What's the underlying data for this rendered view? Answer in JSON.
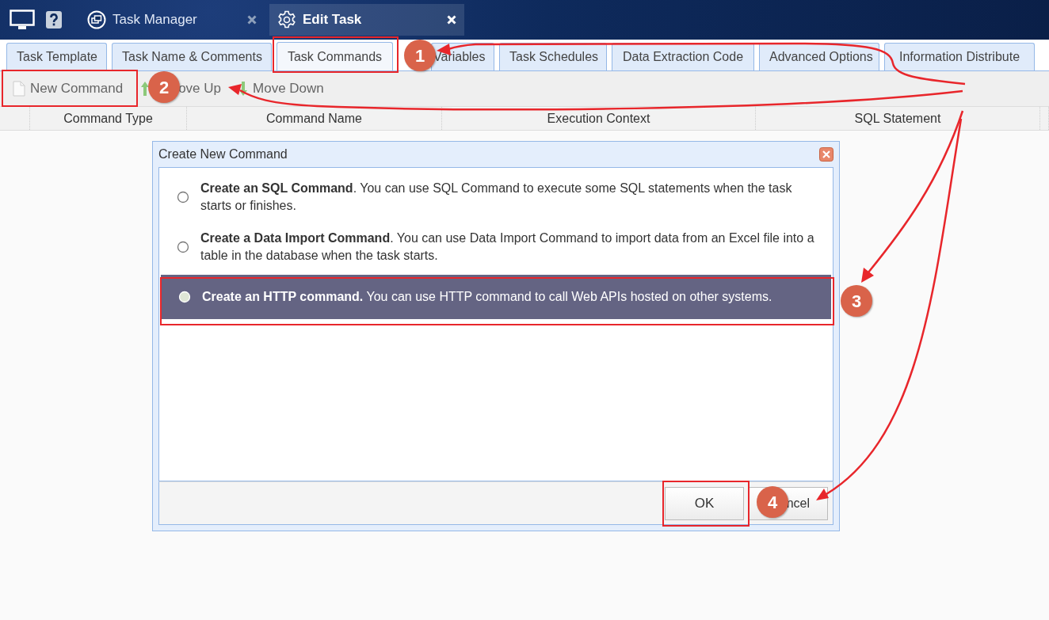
{
  "top_bar": {
    "tabs": [
      {
        "label": "Task Manager",
        "selected": false,
        "kind": "manager"
      },
      {
        "label": "Edit Task",
        "selected": true,
        "kind": "edit"
      }
    ]
  },
  "tabs": [
    {
      "label": "Task Template",
      "selected": false
    },
    {
      "label": "Task Name & Comments",
      "selected": false
    },
    {
      "label": "Task Commands",
      "selected": true
    },
    {
      "label": "Variables",
      "selected": false
    },
    {
      "label": "Task Schedules",
      "selected": false
    },
    {
      "label": "Data Extraction Code",
      "selected": false
    },
    {
      "label": "Advanced Options",
      "selected": false
    },
    {
      "label": "Information Distribute",
      "selected": false
    }
  ],
  "toolbar": {
    "buttons": [
      {
        "label": "New Command",
        "kind": "new"
      },
      {
        "label": "ove Up",
        "kind": "up"
      },
      {
        "label": "Move Down",
        "kind": "down"
      }
    ]
  },
  "table": {
    "columns": [
      "Command Type",
      "Command Name",
      "Execution Context",
      "SQL Statement"
    ]
  },
  "dialog": {
    "title": "Create New Command",
    "options": [
      {
        "text": "**Create an SQL Command**. You can use SQL Command to execute some SQL statements when the task starts or finishes.",
        "selected": false
      },
      {
        "text": "**Create a Data Import Command**. You can use Data Import Command to import data from an Excel file into a table in the database when the task starts.",
        "selected": false
      },
      {
        "text": "**Create an HTTP command.** You can use HTTP command to call Web APIs hosted on other systems.",
        "selected": true
      }
    ],
    "buttons": [
      "OK",
      "ncel"
    ]
  },
  "annotations": [
    {
      "number": "1"
    },
    {
      "number": "2"
    },
    {
      "number": "3"
    },
    {
      "number": "4"
    }
  ]
}
